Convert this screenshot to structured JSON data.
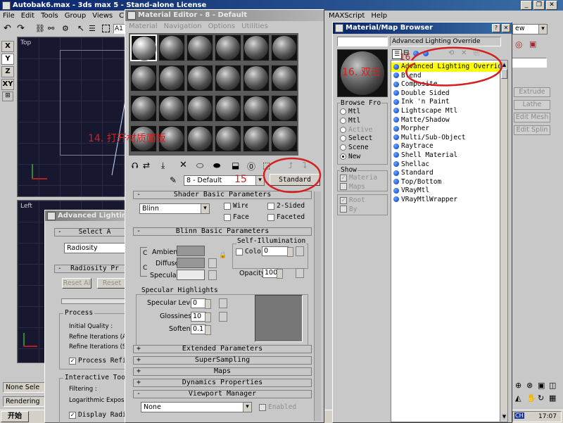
{
  "app": {
    "title": "Autobak6.max - 3ds max 5 - Stand-alone License",
    "menus": [
      "File",
      "Edit",
      "Tools",
      "Group",
      "Views",
      "Create"
    ],
    "menus_right": [
      "MAXScript",
      "Help"
    ],
    "toolbar_field": "A1",
    "view_dropdown": "ew",
    "axis_buttons": [
      "X",
      "Y",
      "Z",
      "XY"
    ],
    "viewport_top_label": "Top",
    "viewport_left_label": "Left",
    "status_left": [
      "None Sele",
      "Rendering"
    ],
    "start_label": "开始",
    "tray_lang": "CH",
    "clock": "17:07",
    "command_panel": {
      "buttons": [
        "Extrude",
        "Lathe",
        "Edit Mesh",
        "Edit Splin"
      ]
    }
  },
  "material_editor": {
    "title": "Material Editor - 8 - Default",
    "menus": [
      "Material",
      "Navigation",
      "Options",
      "Utilities"
    ],
    "material_name": "8 - Default",
    "type_button": "Standard",
    "shader_rollout": {
      "title": "Shader Basic Parameters",
      "shader": "Blinn",
      "wire": "Wire",
      "two_sided": "2-Sided",
      "face_map": "Face Map",
      "faceted": "Faceted"
    },
    "blinn_rollout": {
      "title": "Blinn Basic Parameters",
      "self_illumination": "Self-Illumination",
      "color_label": "Color",
      "color_value": "0",
      "ambient": "Ambient:",
      "diffuse": "Diffuse:",
      "specular": "Specular:",
      "opacity_label": "Opacity:",
      "opacity_value": "100",
      "specular_highlights": "Specular Highlights",
      "specular_level_label": "Specular Level:",
      "specular_level": "0",
      "glossiness_label": "Glossiness:",
      "glossiness": "10",
      "soften_label": "Soften:",
      "soften": "0.1"
    },
    "collapsed_rollouts": [
      "Extended Parameters",
      "SuperSampling",
      "Maps",
      "Dynamics Properties"
    ],
    "viewport_manager": {
      "title": "Viewport Manager",
      "value": "None",
      "enabled": "Enabled"
    }
  },
  "advanced_lighting": {
    "title": "Advanced Lighting",
    "select_rollout": "Select A",
    "plugin": "Radiosity",
    "radiosity_rollout": "Radiosity Pr",
    "reset_all": "Reset Al",
    "reset": "Reset",
    "process_group": "Process",
    "initial_quality": "Initial Quality :",
    "refine_all": "Refine Iterations (All (",
    "refine_sel": "Refine Iterations (Sele",
    "process_refine": "Process Refi",
    "interactive_group": "Interactive Tool",
    "filtering": "Filtering :",
    "log_exposure": "Logarithmic Exposure",
    "display_radiosity": "Display Radi"
  },
  "browser": {
    "title": "Material/Map Browser",
    "field_value": "Advanced Lighting Override",
    "browse_from_label": "Browse Fro",
    "browse_from": [
      {
        "label": "Mtl",
        "selected": false
      },
      {
        "label": "Mtl",
        "selected": false
      },
      {
        "label": "Active",
        "selected": false,
        "disabled": true
      },
      {
        "label": "Select",
        "selected": false
      },
      {
        "label": "Scene",
        "selected": false
      },
      {
        "label": "New",
        "selected": true
      }
    ],
    "show_label": "Show",
    "show": [
      {
        "label": "Materia",
        "checked": true
      },
      {
        "label": "Maps",
        "checked": false
      }
    ],
    "show2": [
      {
        "label": "Root",
        "checked": true
      },
      {
        "label": "By",
        "checked": false
      }
    ],
    "items": [
      "Advanced Lighting Override",
      "Blend",
      "Composite",
      "Double Sided",
      "Ink 'n Paint",
      "Lightscape Mtl",
      "Matte/Shadow",
      "Morpher",
      "Multi/Sub-Object",
      "Raytrace",
      "Shell Material",
      "Shellac",
      "Standard",
      "Top/Bottom",
      "VRayMtl",
      "VRayMtlWrapper"
    ],
    "selected_index": 0
  },
  "annotations": {
    "step14": "14. 打开材质面板",
    "step15": "15",
    "step16": "16. 双击",
    "step16_small": "16"
  },
  "colors": {
    "title_active": "#0a246a",
    "annotation": "#d42020",
    "viewport_bg": "#171730"
  }
}
